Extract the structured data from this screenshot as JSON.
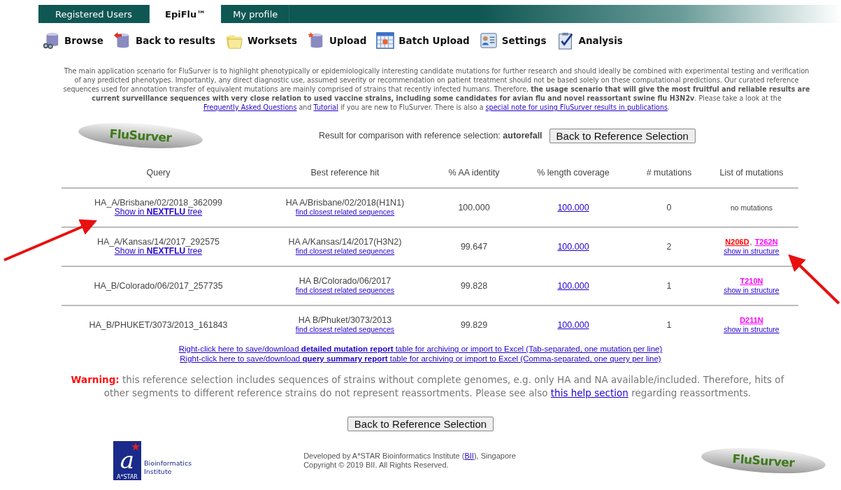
{
  "tabs": [
    {
      "label": "Registered Users",
      "selected": false
    },
    {
      "label": "EpiFlu™",
      "selected": true
    },
    {
      "label": "My profile",
      "selected": false
    }
  ],
  "toolbar": [
    {
      "label": "Browse",
      "kind": "browse"
    },
    {
      "label": "Back to results",
      "kind": "back"
    },
    {
      "label": "Worksets",
      "kind": "folders"
    },
    {
      "label": "Upload",
      "kind": "upload"
    },
    {
      "label": "Batch Upload",
      "kind": "batch"
    },
    {
      "label": "Settings",
      "kind": "settings"
    },
    {
      "label": "Analysis",
      "kind": "analysis"
    }
  ],
  "intro": [
    {
      "kind": "text",
      "text": "The main application scenario for FluSurver is to highlight phenotypically or epidemiologically interesting candidate mutations for further research and should ideally be combined with experimental testing and verification of any predicted phenotypes. Importantly, any direct diagnostic use, assumed severity or recommendation on patient treatment should not be based solely on these computational predictions. Our curated reference sequences used for annotation transfer of equivalent mutations are mainly comprised of strains that recently infected humans. Therefore, **the usage scenario that will give the most fruitful and reliable results are current surveillance sequences with very close relation to used vaccine strains, including some candidates for avian flu and novel reassortant swine flu H3N2v**. Please take a look at the "
    },
    {
      "kind": "link",
      "text": "Frequently Asked Questions"
    },
    {
      "kind": "text",
      "text": " and "
    },
    {
      "kind": "link",
      "text": "Tutorial"
    },
    {
      "kind": "text",
      "text": " if you are new to FluSurver. There is also a "
    },
    {
      "kind": "link",
      "text": "special note for using FluSurver results in publications"
    },
    {
      "kind": "text",
      "text": "."
    }
  ],
  "result_header": {
    "logo": "FluSurver",
    "label": "Result for comparison with reference selection:",
    "selection": "autorefall",
    "button": "Back to Reference Selection"
  },
  "table": {
    "columns": [
      "Query",
      "Best reference hit",
      "% AA identity",
      "% length coverage",
      "# mutations",
      "List of mutations"
    ],
    "rows": [
      {
        "query": "HA_A/Brisbane/02/2018_362099",
        "query_link": "Show in **NEXTFLU** tree",
        "reference": "HA A/Brisbane/02/2018(H1N1)",
        "reference_link": "find closest related sequences",
        "aa_identity": "100.000",
        "coverage": "100.000",
        "mutation_count": "0",
        "mutations": [],
        "no_mutations": "no mutations"
      },
      {
        "query": "HA_A/Kansas/14/2017_292575",
        "query_link": "Show in **NEXTFLU** tree",
        "reference": "HA A/Kansas/14/2017(H3N2)",
        "reference_link": "find closest related sequences",
        "aa_identity": "99.647",
        "coverage": "100.000",
        "mutation_count": "2",
        "mutations": [
          {
            "text": "N206D",
            "color": "#ff0000"
          },
          {
            "text": "T262N",
            "color": "#ff00ff"
          }
        ],
        "separator": ",",
        "structure_link": "show in structure"
      },
      {
        "query": "HA_B/Colorado/06/2017_257735",
        "reference": "HA B/Colorado/06/2017",
        "reference_link": "find closest related sequences",
        "aa_identity": "99.828",
        "coverage": "100.000",
        "mutation_count": "1",
        "mutations": [
          {
            "text": "T210N",
            "color": "#ff00ff"
          }
        ],
        "structure_link": "show in structure"
      },
      {
        "query": "HA_B/PHUKET/3073/2013_161843",
        "reference": "HA B/Phuket/3073/2013",
        "reference_link": "find closest related sequences",
        "aa_identity": "99.829",
        "coverage": "100.000",
        "mutation_count": "1",
        "mutations": [
          {
            "text": "D211N",
            "color": "#ff00ff"
          }
        ],
        "structure_link": "show in structure"
      }
    ]
  },
  "downloads": [
    "Right-click here to save/download **detailed mutation report** table for archiving or import to Excel (Tab-separated, one mutation per line)",
    "Right-click here to save/download **query summary report** table for archiving or import to Excel (Comma-separated, one query per line)"
  ],
  "warning": {
    "label": "Warning:",
    "before": "this reference selection includes sequences of strains without complete genomes, e.g. only HA and NA available/included. Therefore, hits of other segments to different reference strains do not represent reassortments. Please see also ",
    "link": "this help section",
    "after": " regarding reassortments."
  },
  "footer_button": "Back to Reference Selection",
  "footer": {
    "institute_letter": "a",
    "institute_name": "Bioinformatics\nInstitute",
    "institute_org": "A*STAR",
    "developed_before": "Developed by A*STAR Bioinformatics Institute (",
    "developed_link": "BII",
    "developed_after": "), Singapore",
    "copyright": "Copyright © 2019 BII. All Rights Reserved.",
    "logo": "FluSurver"
  },
  "annotation_arrows": [
    {
      "kind": "arrow"
    },
    {
      "kind": "arrow"
    }
  ]
}
